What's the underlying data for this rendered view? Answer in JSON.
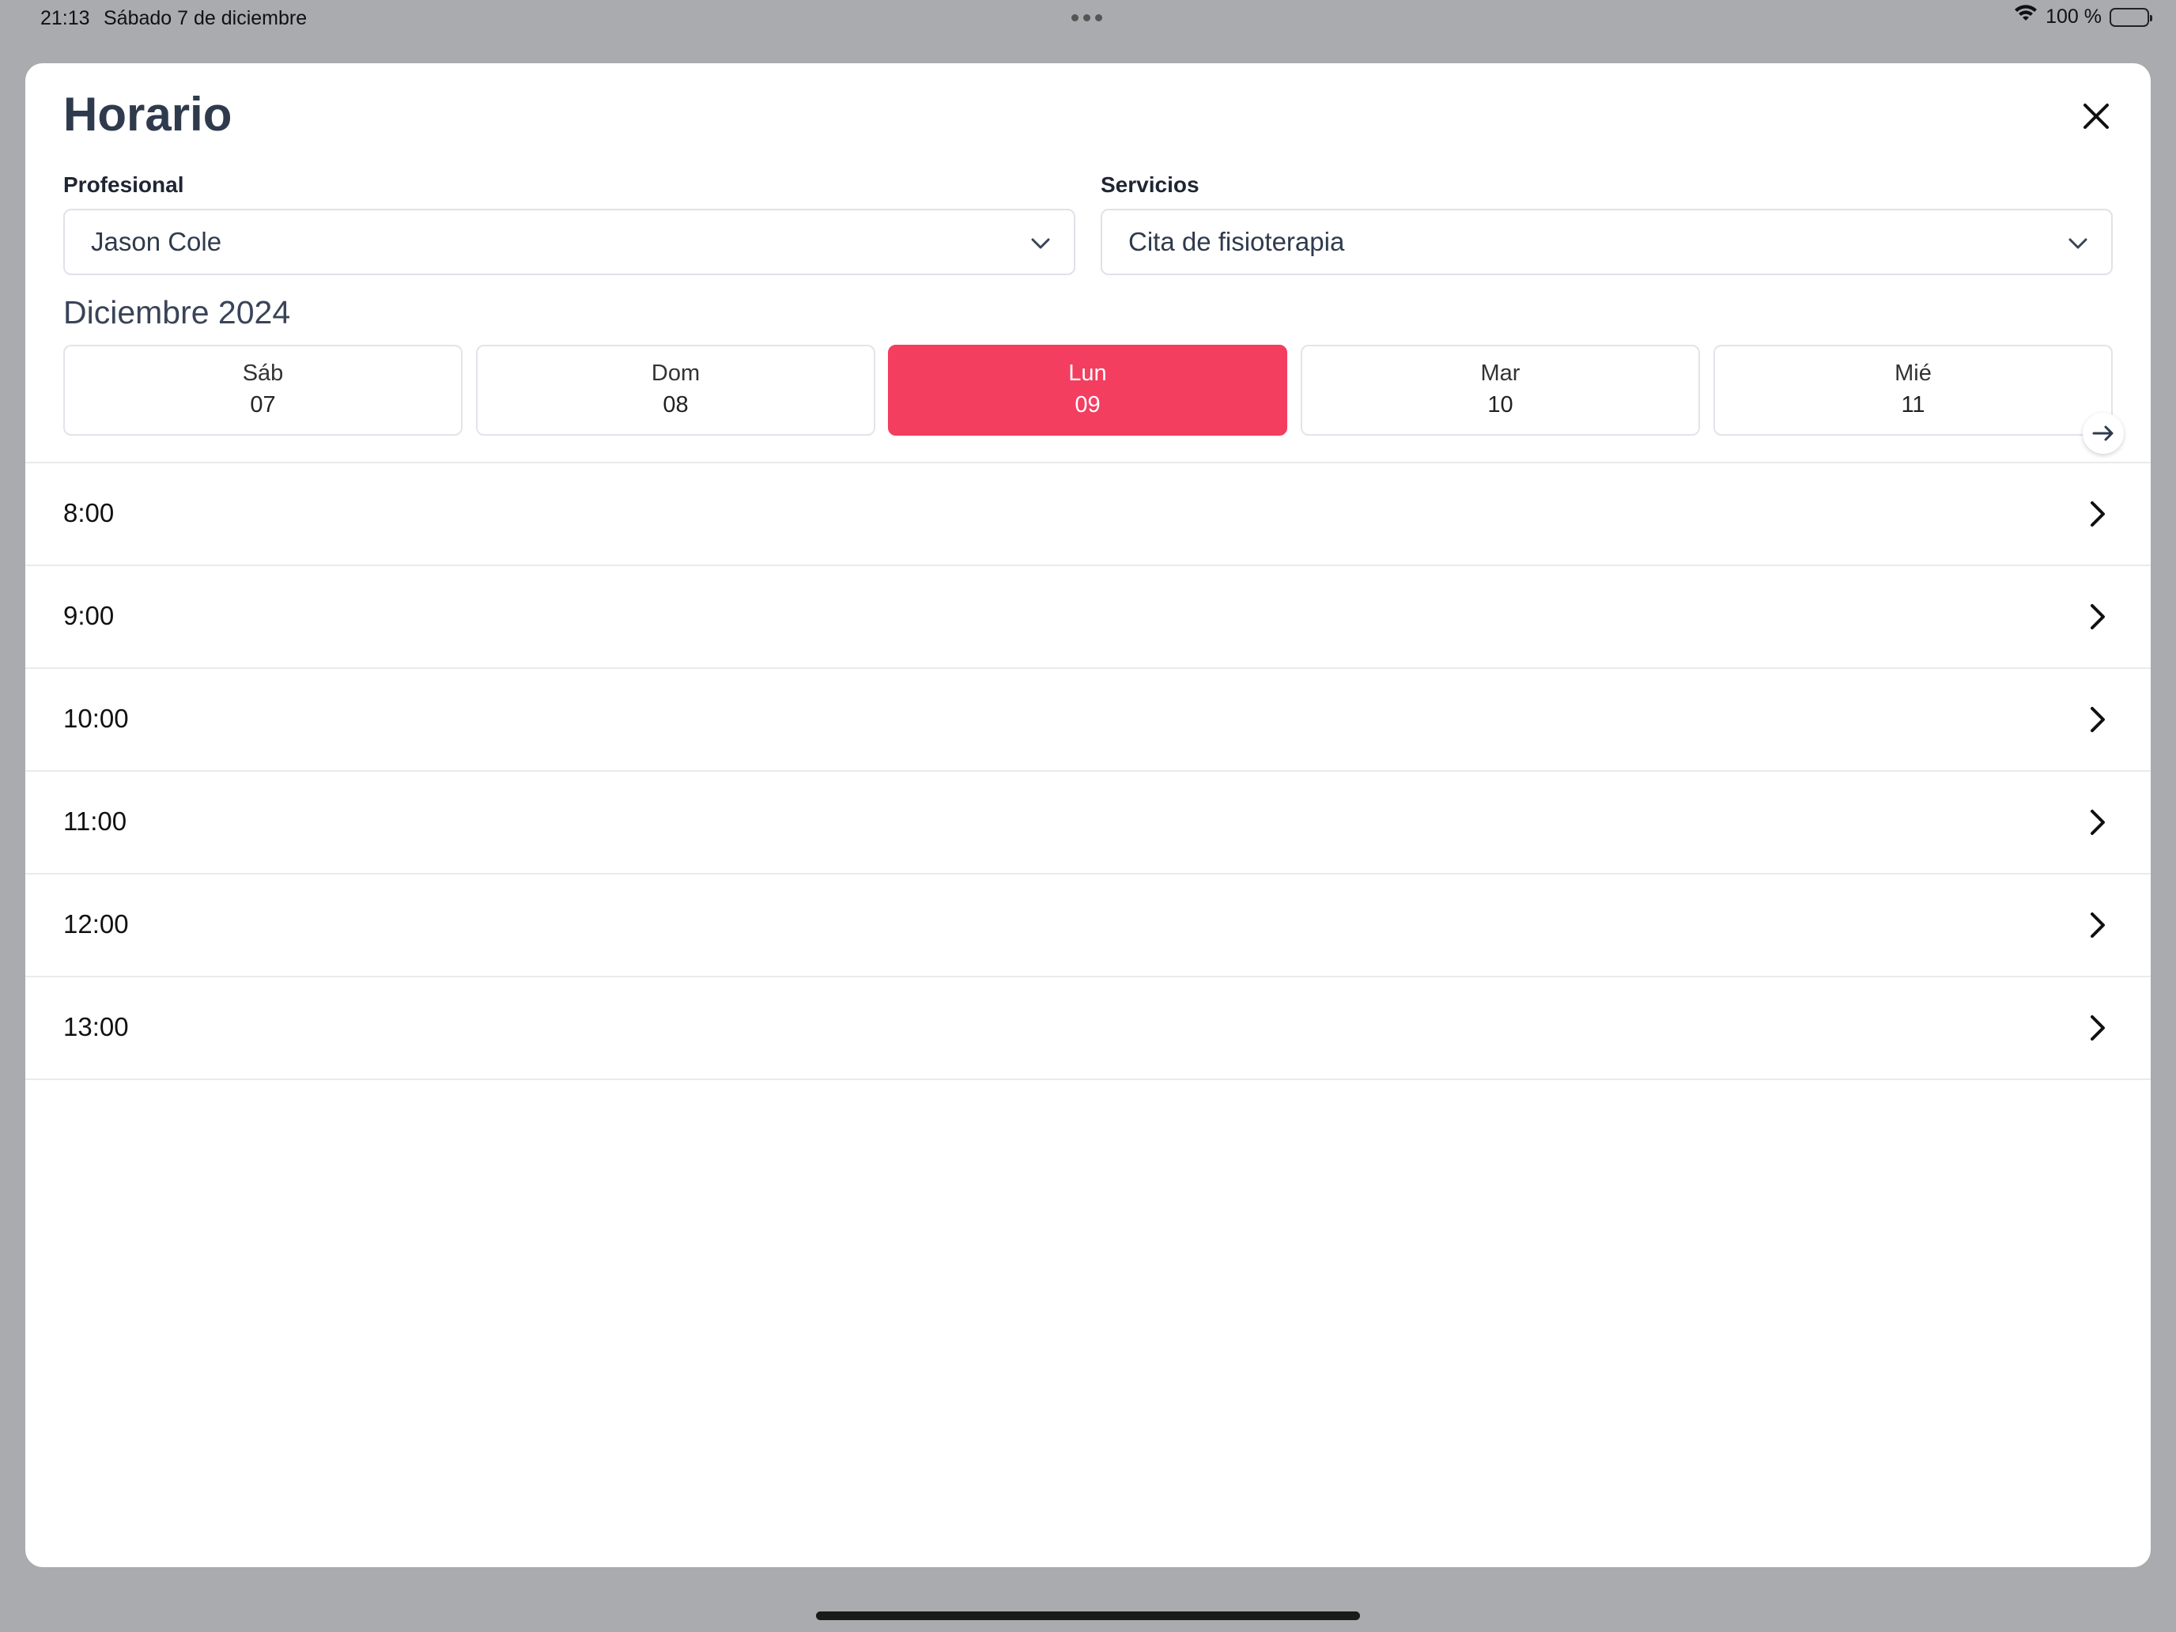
{
  "status_bar": {
    "time": "21:13",
    "date": "Sábado 7 de diciembre",
    "battery_text": "100 %",
    "icons": [
      "wifi-icon",
      "battery-icon"
    ]
  },
  "modal": {
    "title": "Horario",
    "close_icon": "close-icon",
    "professional": {
      "label": "Profesional",
      "value": "Jason Cole"
    },
    "services": {
      "label": "Servicios",
      "value": "Cita de fisioterapia"
    },
    "month": "Diciembre 2024",
    "days": [
      {
        "dow": "Sáb",
        "num": "07",
        "selected": false
      },
      {
        "dow": "Dom",
        "num": "08",
        "selected": false
      },
      {
        "dow": "Lun",
        "num": "09",
        "selected": true
      },
      {
        "dow": "Mar",
        "num": "10",
        "selected": false
      },
      {
        "dow": "Mié",
        "num": "11",
        "selected": false
      }
    ],
    "slots": [
      "8:00",
      "9:00",
      "10:00",
      "11:00",
      "12:00",
      "13:00"
    ]
  },
  "colors": {
    "accent": "#f33e60",
    "title": "#2f3a4d",
    "backdrop": "#a9abaf"
  }
}
